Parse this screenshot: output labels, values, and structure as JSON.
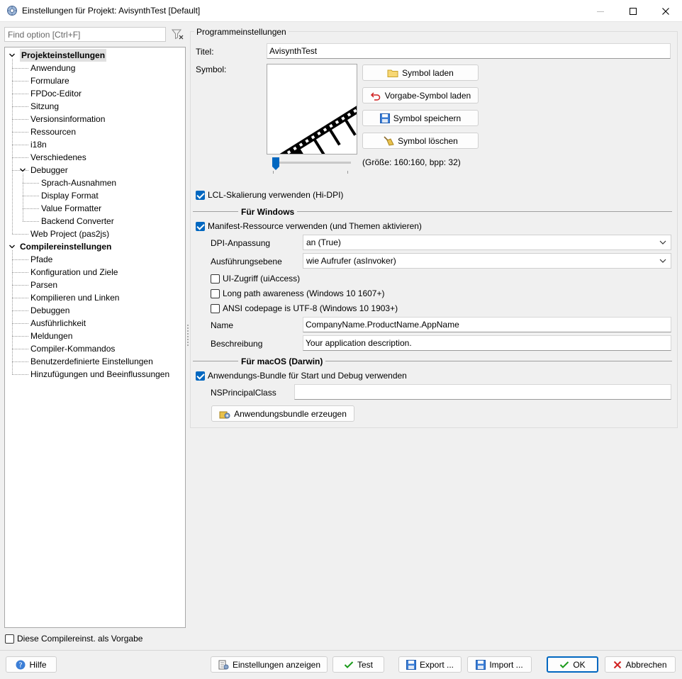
{
  "window": {
    "title": "Einstellungen für Projekt: AvisynthTest [Default]"
  },
  "search": {
    "placeholder": "Find option [Ctrl+F]",
    "value": ""
  },
  "tree": [
    {
      "label": "Projekteinstellungen",
      "level": 0,
      "bold": true,
      "selected": true,
      "expanded": true
    },
    {
      "label": "Anwendung",
      "level": 1
    },
    {
      "label": "Formulare",
      "level": 1
    },
    {
      "label": "FPDoc-Editor",
      "level": 1
    },
    {
      "label": "Sitzung",
      "level": 1
    },
    {
      "label": "Versionsinformation",
      "level": 1
    },
    {
      "label": "Ressourcen",
      "level": 1
    },
    {
      "label": "i18n",
      "level": 1
    },
    {
      "label": "Verschiedenes",
      "level": 1
    },
    {
      "label": "Debugger",
      "level": 1,
      "expanded": true
    },
    {
      "label": "Sprach-Ausnahmen",
      "level": 2
    },
    {
      "label": "Display Format",
      "level": 2
    },
    {
      "label": "Value Formatter",
      "level": 2
    },
    {
      "label": "Backend Converter",
      "level": 2
    },
    {
      "label": "Web Project (pas2js)",
      "level": 1
    },
    {
      "label": "Compilereinstellungen",
      "level": 0,
      "bold": true,
      "expanded": true
    },
    {
      "label": "Pfade",
      "level": 1
    },
    {
      "label": "Konfiguration und Ziele",
      "level": 1
    },
    {
      "label": "Parsen",
      "level": 1
    },
    {
      "label": "Kompilieren und Linken",
      "level": 1
    },
    {
      "label": "Debuggen",
      "level": 1
    },
    {
      "label": "Ausführlichkeit",
      "level": 1
    },
    {
      "label": "Meldungen",
      "level": 1
    },
    {
      "label": "Compiler-Kommandos",
      "level": 1
    },
    {
      "label": "Benutzerdefinierte Einstellungen",
      "level": 1
    },
    {
      "label": "Hinzufügungen und Beeinflussungen",
      "level": 1
    }
  ],
  "default_checkbox": {
    "label": "Diese Compilereinst. als Vorgabe",
    "checked": false
  },
  "group": {
    "title": "Programmeinstellungen"
  },
  "titel": {
    "label": "Titel:",
    "value": "AvisynthTest"
  },
  "symbol": {
    "label": "Symbol:",
    "load_button": "Symbol laden",
    "default_button": "Vorgabe-Symbol laden",
    "save_button": "Symbol speichern",
    "delete_button": "Symbol löschen",
    "size_text": "(Größe: 160:160, bpp: 32)",
    "size_level": 0.0
  },
  "lcl_scaling": {
    "label": "LCL-Skalierung verwenden (Hi-DPI)",
    "checked": true
  },
  "windows": {
    "section_title": "Für Windows",
    "manifest": {
      "label": "Manifest-Ressource verwenden (und Themen aktivieren)",
      "checked": true
    },
    "dpi": {
      "label": "DPI-Anpassung",
      "value": "an (True)"
    },
    "execution": {
      "label": "Ausführungsebene",
      "value": "wie Aufrufer (asInvoker)"
    },
    "ui_access": {
      "label": "UI-Zugriff (uiAccess)",
      "checked": false
    },
    "long_path": {
      "label": "Long path awareness (Windows 10 1607+)",
      "checked": false
    },
    "ansi_codepage": {
      "label": "ANSI codepage is UTF-8 (Windows 10 1903+)",
      "checked": false
    },
    "name": {
      "label": "Name",
      "value": "CompanyName.ProductName.AppName"
    },
    "description": {
      "label": "Beschreibung",
      "value": "Your application description."
    }
  },
  "macos": {
    "section_title": "Für macOS (Darwin)",
    "bundle": {
      "label": "Anwendungs-Bundle für Start und Debug verwenden",
      "checked": true
    },
    "principal": {
      "label": "NSPrincipalClass",
      "value": ""
    },
    "create_button": "Anwendungsbundle erzeugen"
  },
  "footer": {
    "help": "Hilfe",
    "show_options": "Einstellungen anzeigen",
    "test": "Test",
    "export": "Export ...",
    "import": "Import ...",
    "ok": "OK",
    "cancel": "Abbrechen"
  },
  "colors": {
    "accent": "#0067c0",
    "ok_border": "#0067c0"
  }
}
